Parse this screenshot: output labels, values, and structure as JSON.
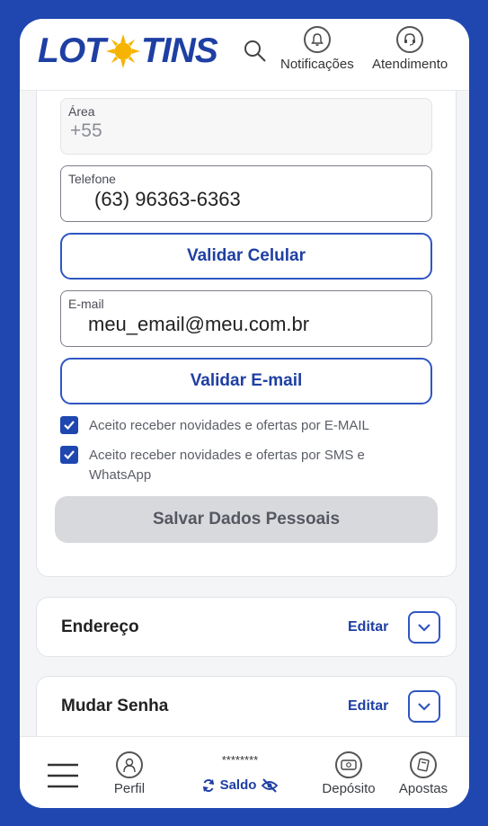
{
  "header": {
    "logo_left": "LOT",
    "logo_right": "TINS",
    "notifications_label": "Notificações",
    "support_label": "Atendimento"
  },
  "form": {
    "area": {
      "label": "Área",
      "value": "+55"
    },
    "phone": {
      "label": "Telefone",
      "value": "(63) 96363-6363"
    },
    "validate_phone_label": "Validar Celular",
    "email": {
      "label": "E-mail",
      "value": "meu_email@meu.com.br"
    },
    "validate_email_label": "Validar E-mail",
    "opt_email_label": "Aceito receber novidades e ofertas por E-MAIL",
    "opt_sms_label": "Aceito receber novidades e ofertas por SMS e WhatsApp",
    "save_label": "Salvar Dados Pessoais"
  },
  "sections": [
    {
      "title": "Endereço",
      "edit_label": "Editar"
    },
    {
      "title": "Mudar Senha",
      "edit_label": "Editar"
    }
  ],
  "bottom_nav": {
    "profile_label": "Perfil",
    "balance_mask": "********",
    "balance_label": "Saldo",
    "deposit_label": "Depósito",
    "bets_label": "Apostas"
  },
  "colors": {
    "brand": "#1e3fa3",
    "frame": "#2047b0",
    "sun": "#f6b400"
  },
  "icons": [
    "search-icon",
    "bell-icon",
    "headset-icon",
    "chevron-down-icon",
    "menu-icon",
    "user-icon",
    "refresh-icon",
    "eye-off-icon",
    "cash-icon",
    "ticket-icon",
    "checkbox-checked-icon"
  ]
}
